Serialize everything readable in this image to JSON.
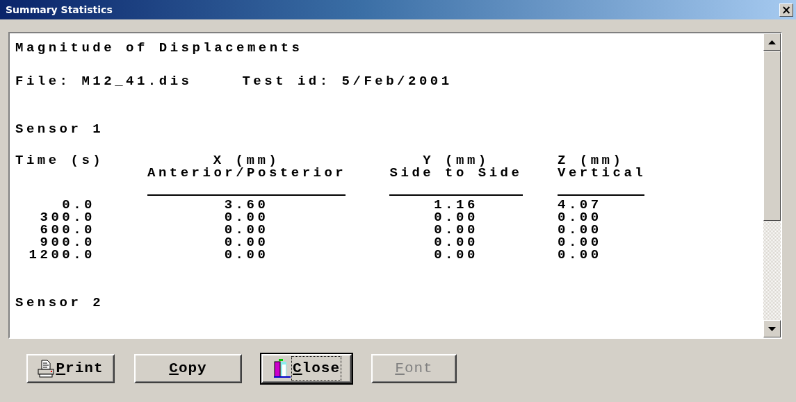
{
  "window": {
    "title": "Summary Statistics",
    "close_glyph": "×"
  },
  "report": {
    "title": "Magnitude of Displacements",
    "file_label": "File:",
    "file": "M12_41.dis",
    "test_label": "Test id:",
    "test_id": "5/Feb/2001",
    "sections": [
      {
        "heading": "Sensor 1",
        "columns": [
          {
            "name": "Time (s)"
          },
          {
            "name": "X (mm)",
            "subtitle": "Anterior/Posterior"
          },
          {
            "name": "Y (mm)",
            "subtitle": "Side to Side"
          },
          {
            "name": "Z (mm)",
            "subtitle": "Vertical"
          }
        ],
        "rows": [
          [
            "0.0",
            "3.60",
            "1.16",
            "4.07"
          ],
          [
            "300.0",
            "0.00",
            "0.00",
            "0.00"
          ],
          [
            "600.0",
            "0.00",
            "0.00",
            "0.00"
          ],
          [
            "900.0",
            "0.00",
            "0.00",
            "0.00"
          ],
          [
            "1200.0",
            "0.00",
            "0.00",
            "0.00"
          ]
        ]
      },
      {
        "heading": "Sensor 2"
      }
    ]
  },
  "buttons": [
    {
      "label": "Print",
      "kind": "print",
      "disabled": false,
      "focused": false
    },
    {
      "label": "Copy",
      "kind": "plain",
      "disabled": false,
      "focused": false
    },
    {
      "label": "Close",
      "kind": "close",
      "disabled": false,
      "focused": true
    },
    {
      "label": "Font",
      "kind": "plain",
      "disabled": true,
      "focused": false
    }
  ]
}
